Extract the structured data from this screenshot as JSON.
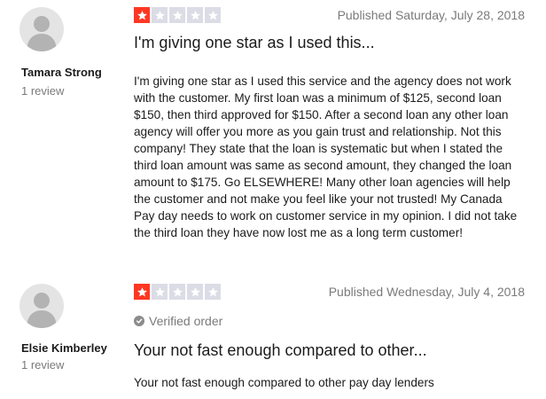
{
  "reviews": [
    {
      "author": "Tamara Strong",
      "review_count": "1 review",
      "rating": 1,
      "max_rating": 5,
      "published": "Published Saturday, July 28, 2018",
      "verified": "",
      "title": "I'm giving one star as I used this...",
      "body": "I'm giving one star as I used this service and the agency does not work with the customer. My first loan was a minimum of $125, second loan $150, then third approved for $150. After a second loan any other loan agency will offer you more as you gain trust and relationship. Not this company! They state that the loan is systematic but when I stated the third loan amount was same as second amount, they changed the loan amount to $175. Go ELSEWHERE! Many other loan agencies will help the customer and not make you feel like your not trusted! My Canada Pay day needs to work on customer service in my opinion. I did not take the third loan they have now lost me as a long term customer!"
    },
    {
      "author": "Elsie Kimberley",
      "review_count": "1 review",
      "rating": 1,
      "max_rating": 5,
      "published": "Published Wednesday, July 4, 2018",
      "verified": "Verified order",
      "title": "Your not fast enough compared to other...",
      "body": "Your not fast enough compared to other pay day lenders"
    }
  ],
  "colors": {
    "star_filled": "#ff3722",
    "star_empty": "#dcdce6",
    "muted_text": "#7a7a7a",
    "avatar_bg": "#e4e4e4",
    "avatar_fg": "#b3b3b3"
  },
  "icons": {
    "star": "star-icon",
    "avatar": "user-silhouette-icon",
    "verified": "check-circle-icon"
  }
}
